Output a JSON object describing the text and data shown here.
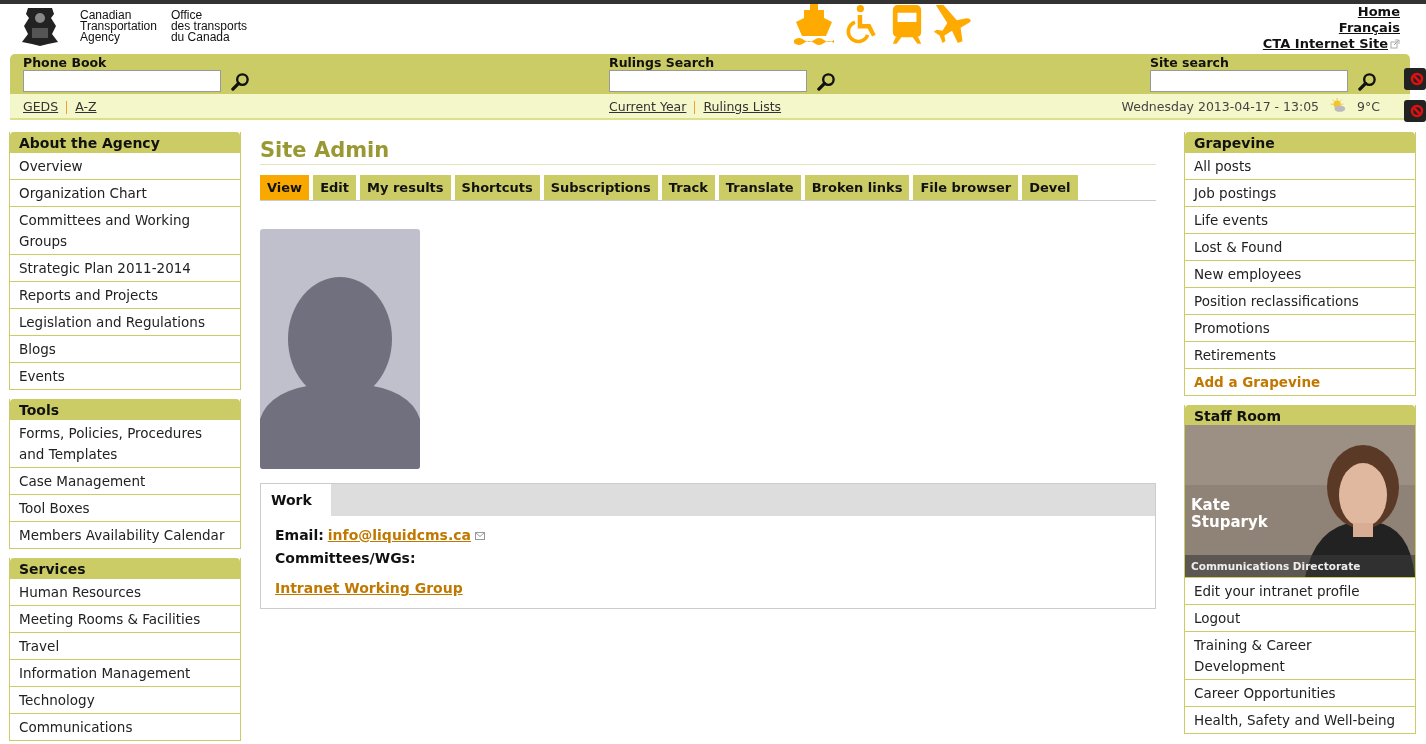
{
  "header": {
    "agency_en": [
      "Canadian",
      "Transportation",
      "Agency"
    ],
    "agency_fr": [
      "Office",
      "des transports",
      "du Canada"
    ],
    "links": [
      {
        "label": "Home",
        "external": false
      },
      {
        "label": "Français",
        "external": false
      },
      {
        "label": "CTA Internet Site",
        "external": true
      }
    ]
  },
  "searches": [
    {
      "label": "Phone Book"
    },
    {
      "label": "Rulings Search"
    },
    {
      "label": "Site search"
    }
  ],
  "subbar": {
    "left_links": [
      "GEDS",
      "A-Z"
    ],
    "center_links": [
      "Current Year",
      "Rulings Lists"
    ],
    "datetime": "Wednesday 2013-04-17 - 13:05",
    "temperature": "9°C"
  },
  "left_sidebar": [
    {
      "title": "About the Agency",
      "items": [
        "Overview",
        "Organization Chart",
        "Committees and Working Groups",
        "Strategic Plan 2011-2014",
        "Reports and Projects",
        "Legislation and Regulations",
        "Blogs",
        "Events"
      ]
    },
    {
      "title": "Tools",
      "items": [
        "Forms, Policies, Procedures and Templates",
        "Case Management",
        "Tool Boxes",
        "Members Availability Calendar"
      ]
    },
    {
      "title": "Services",
      "items": [
        "Human Resources",
        "Meeting Rooms & Facilities",
        "Travel",
        "Information Management",
        "Technology",
        "Communications"
      ]
    }
  ],
  "main": {
    "title": "Site Admin",
    "tabs": [
      {
        "label": "View",
        "selected": true
      },
      {
        "label": "Edit",
        "selected": false
      },
      {
        "label": "My results",
        "selected": false
      },
      {
        "label": "Shortcuts",
        "selected": false
      },
      {
        "label": "Subscriptions",
        "selected": false
      },
      {
        "label": "Track",
        "selected": false
      },
      {
        "label": "Translate",
        "selected": false
      },
      {
        "label": "Broken links",
        "selected": false
      },
      {
        "label": "File browser",
        "selected": false
      },
      {
        "label": "Devel",
        "selected": false
      }
    ],
    "profile": {
      "tab": "Work",
      "email_label": "Email:",
      "email": "info@liquidcms.ca",
      "committees_label": "Committees/WGs:",
      "committee": "Intranet Working Group"
    }
  },
  "right_sidebar": [
    {
      "title": "Grapevine",
      "items": [
        {
          "label": "All posts",
          "kind": "link"
        },
        {
          "label": "Job postings",
          "kind": "link"
        },
        {
          "label": "Life events",
          "kind": "link"
        },
        {
          "label": "Lost & Found",
          "kind": "link"
        },
        {
          "label": "New employees",
          "kind": "link"
        },
        {
          "label": "Position reclassifications",
          "kind": "link"
        },
        {
          "label": "Promotions",
          "kind": "link"
        },
        {
          "label": "Retirements",
          "kind": "link"
        },
        {
          "label": "Add a Grapevine",
          "kind": "action"
        }
      ]
    },
    {
      "title": "Staff Room",
      "photo": {
        "kind": "picture",
        "name": [
          "Kate",
          "Stuparyk"
        ],
        "caption": "Communications Directorate"
      },
      "items": [
        {
          "label": "Edit your intranet profile",
          "kind": "link"
        },
        {
          "label": "Logout",
          "kind": "link"
        },
        {
          "label": "Training & Career Development",
          "kind": "link"
        },
        {
          "label": "Career Opportunities",
          "kind": "link"
        },
        {
          "label": "Health, Safety and Well-being",
          "kind": "link"
        }
      ]
    }
  ]
}
